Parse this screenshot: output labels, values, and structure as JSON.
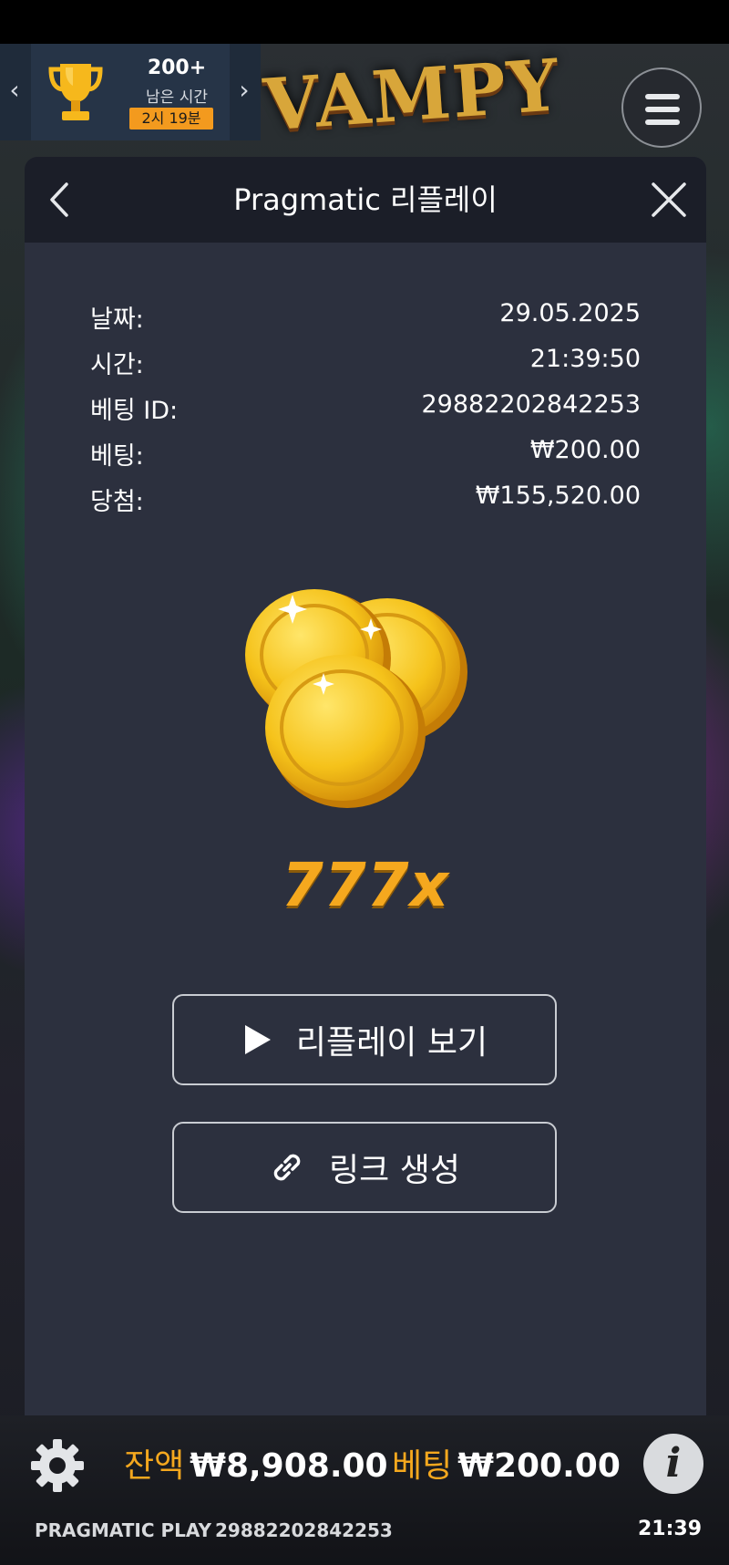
{
  "game": {
    "logo_text": "VAMPY"
  },
  "tournament": {
    "points": "200+",
    "remaining_label": "남은 시간",
    "timer": "2시 19분"
  },
  "modal": {
    "title": "Pragmatic 리플레이",
    "rows": [
      {
        "label": "날짜:",
        "value": "29.05.2025"
      },
      {
        "label": "시간:",
        "value": "21:39:50"
      },
      {
        "label": "베팅 ID:",
        "value": "29882202842253"
      },
      {
        "label": "베팅:",
        "value": "₩200.00"
      },
      {
        "label": "당첨:",
        "value": "₩155,520.00"
      }
    ],
    "multiplier": "777x",
    "replay_button": "리플레이 보기",
    "link_button": "링크 생성"
  },
  "bottom_bar": {
    "balance_label": "잔액",
    "balance_value": "₩8,908.00",
    "bet_label": "베팅",
    "bet_value": "₩200.00",
    "brand": "PRAGMATIC PLAY",
    "round_id": "29882202842253",
    "clock": "21:39"
  },
  "colors": {
    "accent": "#f5a81e",
    "modal_bg": "#2c303e",
    "header_bg": "#1b1e28"
  },
  "icons": [
    "trophy-icon",
    "chevron-left-icon",
    "chevron-right-icon",
    "hamburger-menu-icon",
    "back-chevron-icon",
    "close-icon",
    "coins-icon",
    "play-icon",
    "link-icon",
    "gear-icon",
    "info-icon"
  ]
}
